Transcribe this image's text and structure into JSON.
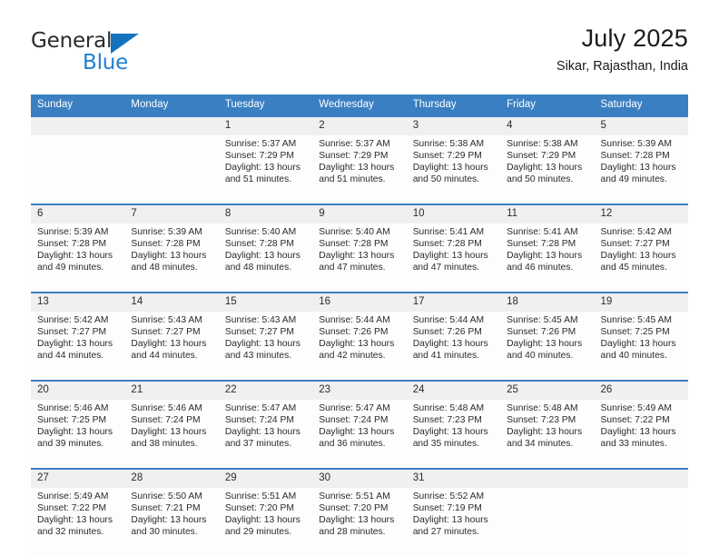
{
  "brand": {
    "name_part1": "General",
    "name_part2": "Blue",
    "triangle_icon": "triangle-icon",
    "color_dark": "#2b2b2b",
    "color_blue": "#1f7fd0"
  },
  "header": {
    "title": "July 2025",
    "subtitle": "Sikar, Rajasthan, India"
  },
  "theme": {
    "header_blue": "#3a7fc1",
    "daynum_band": "#f0f0f0",
    "cell_bg": "#fdfdfd"
  },
  "weekday_headers": [
    "Sunday",
    "Monday",
    "Tuesday",
    "Wednesday",
    "Thursday",
    "Friday",
    "Saturday"
  ],
  "weeks": [
    [
      {
        "day": "",
        "sunrise": "",
        "sunset": "",
        "daylight_line1": "",
        "daylight_line2": ""
      },
      {
        "day": "",
        "sunrise": "",
        "sunset": "",
        "daylight_line1": "",
        "daylight_line2": ""
      },
      {
        "day": "1",
        "sunrise": "Sunrise: 5:37 AM",
        "sunset": "Sunset: 7:29 PM",
        "daylight_line1": "Daylight: 13 hours",
        "daylight_line2": "and 51 minutes."
      },
      {
        "day": "2",
        "sunrise": "Sunrise: 5:37 AM",
        "sunset": "Sunset: 7:29 PM",
        "daylight_line1": "Daylight: 13 hours",
        "daylight_line2": "and 51 minutes."
      },
      {
        "day": "3",
        "sunrise": "Sunrise: 5:38 AM",
        "sunset": "Sunset: 7:29 PM",
        "daylight_line1": "Daylight: 13 hours",
        "daylight_line2": "and 50 minutes."
      },
      {
        "day": "4",
        "sunrise": "Sunrise: 5:38 AM",
        "sunset": "Sunset: 7:29 PM",
        "daylight_line1": "Daylight: 13 hours",
        "daylight_line2": "and 50 minutes."
      },
      {
        "day": "5",
        "sunrise": "Sunrise: 5:39 AM",
        "sunset": "Sunset: 7:28 PM",
        "daylight_line1": "Daylight: 13 hours",
        "daylight_line2": "and 49 minutes."
      }
    ],
    [
      {
        "day": "6",
        "sunrise": "Sunrise: 5:39 AM",
        "sunset": "Sunset: 7:28 PM",
        "daylight_line1": "Daylight: 13 hours",
        "daylight_line2": "and 49 minutes."
      },
      {
        "day": "7",
        "sunrise": "Sunrise: 5:39 AM",
        "sunset": "Sunset: 7:28 PM",
        "daylight_line1": "Daylight: 13 hours",
        "daylight_line2": "and 48 minutes."
      },
      {
        "day": "8",
        "sunrise": "Sunrise: 5:40 AM",
        "sunset": "Sunset: 7:28 PM",
        "daylight_line1": "Daylight: 13 hours",
        "daylight_line2": "and 48 minutes."
      },
      {
        "day": "9",
        "sunrise": "Sunrise: 5:40 AM",
        "sunset": "Sunset: 7:28 PM",
        "daylight_line1": "Daylight: 13 hours",
        "daylight_line2": "and 47 minutes."
      },
      {
        "day": "10",
        "sunrise": "Sunrise: 5:41 AM",
        "sunset": "Sunset: 7:28 PM",
        "daylight_line1": "Daylight: 13 hours",
        "daylight_line2": "and 47 minutes."
      },
      {
        "day": "11",
        "sunrise": "Sunrise: 5:41 AM",
        "sunset": "Sunset: 7:28 PM",
        "daylight_line1": "Daylight: 13 hours",
        "daylight_line2": "and 46 minutes."
      },
      {
        "day": "12",
        "sunrise": "Sunrise: 5:42 AM",
        "sunset": "Sunset: 7:27 PM",
        "daylight_line1": "Daylight: 13 hours",
        "daylight_line2": "and 45 minutes."
      }
    ],
    [
      {
        "day": "13",
        "sunrise": "Sunrise: 5:42 AM",
        "sunset": "Sunset: 7:27 PM",
        "daylight_line1": "Daylight: 13 hours",
        "daylight_line2": "and 44 minutes."
      },
      {
        "day": "14",
        "sunrise": "Sunrise: 5:43 AM",
        "sunset": "Sunset: 7:27 PM",
        "daylight_line1": "Daylight: 13 hours",
        "daylight_line2": "and 44 minutes."
      },
      {
        "day": "15",
        "sunrise": "Sunrise: 5:43 AM",
        "sunset": "Sunset: 7:27 PM",
        "daylight_line1": "Daylight: 13 hours",
        "daylight_line2": "and 43 minutes."
      },
      {
        "day": "16",
        "sunrise": "Sunrise: 5:44 AM",
        "sunset": "Sunset: 7:26 PM",
        "daylight_line1": "Daylight: 13 hours",
        "daylight_line2": "and 42 minutes."
      },
      {
        "day": "17",
        "sunrise": "Sunrise: 5:44 AM",
        "sunset": "Sunset: 7:26 PM",
        "daylight_line1": "Daylight: 13 hours",
        "daylight_line2": "and 41 minutes."
      },
      {
        "day": "18",
        "sunrise": "Sunrise: 5:45 AM",
        "sunset": "Sunset: 7:26 PM",
        "daylight_line1": "Daylight: 13 hours",
        "daylight_line2": "and 40 minutes."
      },
      {
        "day": "19",
        "sunrise": "Sunrise: 5:45 AM",
        "sunset": "Sunset: 7:25 PM",
        "daylight_line1": "Daylight: 13 hours",
        "daylight_line2": "and 40 minutes."
      }
    ],
    [
      {
        "day": "20",
        "sunrise": "Sunrise: 5:46 AM",
        "sunset": "Sunset: 7:25 PM",
        "daylight_line1": "Daylight: 13 hours",
        "daylight_line2": "and 39 minutes."
      },
      {
        "day": "21",
        "sunrise": "Sunrise: 5:46 AM",
        "sunset": "Sunset: 7:24 PM",
        "daylight_line1": "Daylight: 13 hours",
        "daylight_line2": "and 38 minutes."
      },
      {
        "day": "22",
        "sunrise": "Sunrise: 5:47 AM",
        "sunset": "Sunset: 7:24 PM",
        "daylight_line1": "Daylight: 13 hours",
        "daylight_line2": "and 37 minutes."
      },
      {
        "day": "23",
        "sunrise": "Sunrise: 5:47 AM",
        "sunset": "Sunset: 7:24 PM",
        "daylight_line1": "Daylight: 13 hours",
        "daylight_line2": "and 36 minutes."
      },
      {
        "day": "24",
        "sunrise": "Sunrise: 5:48 AM",
        "sunset": "Sunset: 7:23 PM",
        "daylight_line1": "Daylight: 13 hours",
        "daylight_line2": "and 35 minutes."
      },
      {
        "day": "25",
        "sunrise": "Sunrise: 5:48 AM",
        "sunset": "Sunset: 7:23 PM",
        "daylight_line1": "Daylight: 13 hours",
        "daylight_line2": "and 34 minutes."
      },
      {
        "day": "26",
        "sunrise": "Sunrise: 5:49 AM",
        "sunset": "Sunset: 7:22 PM",
        "daylight_line1": "Daylight: 13 hours",
        "daylight_line2": "and 33 minutes."
      }
    ],
    [
      {
        "day": "27",
        "sunrise": "Sunrise: 5:49 AM",
        "sunset": "Sunset: 7:22 PM",
        "daylight_line1": "Daylight: 13 hours",
        "daylight_line2": "and 32 minutes."
      },
      {
        "day": "28",
        "sunrise": "Sunrise: 5:50 AM",
        "sunset": "Sunset: 7:21 PM",
        "daylight_line1": "Daylight: 13 hours",
        "daylight_line2": "and 30 minutes."
      },
      {
        "day": "29",
        "sunrise": "Sunrise: 5:51 AM",
        "sunset": "Sunset: 7:20 PM",
        "daylight_line1": "Daylight: 13 hours",
        "daylight_line2": "and 29 minutes."
      },
      {
        "day": "30",
        "sunrise": "Sunrise: 5:51 AM",
        "sunset": "Sunset: 7:20 PM",
        "daylight_line1": "Daylight: 13 hours",
        "daylight_line2": "and 28 minutes."
      },
      {
        "day": "31",
        "sunrise": "Sunrise: 5:52 AM",
        "sunset": "Sunset: 7:19 PM",
        "daylight_line1": "Daylight: 13 hours",
        "daylight_line2": "and 27 minutes."
      },
      {
        "day": "",
        "sunrise": "",
        "sunset": "",
        "daylight_line1": "",
        "daylight_line2": ""
      },
      {
        "day": "",
        "sunrise": "",
        "sunset": "",
        "daylight_line1": "",
        "daylight_line2": ""
      }
    ]
  ]
}
